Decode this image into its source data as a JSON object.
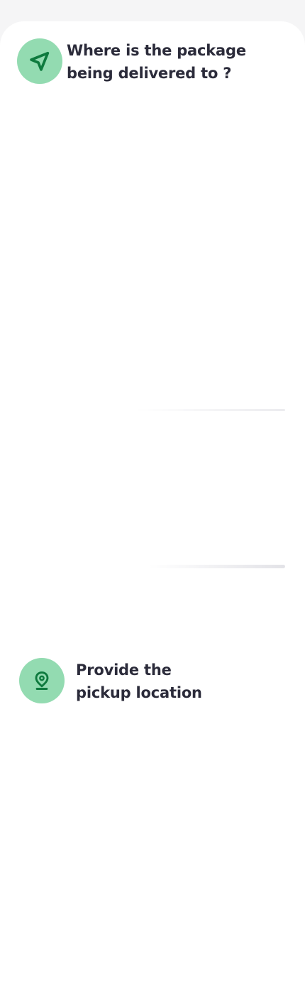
{
  "delivery": {
    "title_lines": [
      "Where is the package",
      "being delivered to ?"
    ],
    "icon": "navigation-arrow-icon"
  },
  "pickup": {
    "title_lines": [
      "Provide the",
      "pickup location"
    ],
    "icon": "map-pin-icon"
  },
  "colors": {
    "page_background": "#f5f5f6",
    "card_background": "#ffffff",
    "badge_fill": "#93dbb1",
    "icon_color": "#0e7a3e",
    "heading_text": "#2b2b3a"
  }
}
